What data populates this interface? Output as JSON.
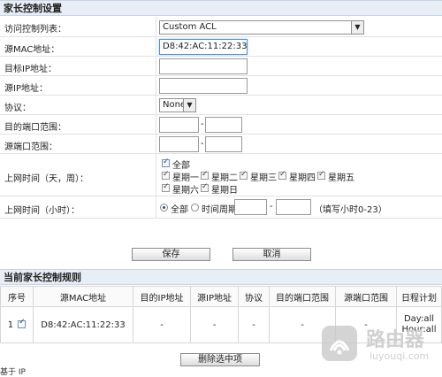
{
  "section1": {
    "title": "家长控制设置"
  },
  "form": {
    "acl_label": "访问控制列表：",
    "acl_value": "Custom ACL",
    "src_mac_label": "源MAC地址：",
    "src_mac_value": "D8:42:AC:11:22:33",
    "dst_ip_label": "目标IP地址：",
    "src_ip_label": "源IP地址：",
    "protocol_label": "协议：",
    "protocol_value": "None",
    "dst_port_label": "目的端口范围：",
    "src_port_label": "源端口范围：",
    "range_dash": "-",
    "week_label": "上网时间（天，周）：",
    "days": {
      "all": "全部",
      "mon": "星期一",
      "tue": "星期二",
      "wed": "星期三",
      "thu": "星期四",
      "fri": "星期五",
      "sat": "星期六",
      "sun": "星期日"
    },
    "hour_label": "上网时间（小时）：",
    "hour_all": "全部",
    "hour_period": "时间周期",
    "hour_hint": "（填写小时0-23）"
  },
  "buttons": {
    "save": "保存",
    "cancel": "取消",
    "delete_selected": "删除选中项"
  },
  "section2": {
    "title": "当前家长控制规则"
  },
  "rules_table": {
    "headers": [
      "序号",
      "源MAC地址",
      "目的IP地址",
      "源IP地址",
      "协议",
      "目的端口范围",
      "源端口范围",
      "日程计划"
    ],
    "rows": [
      {
        "index": "1",
        "src_mac": "D8:42:AC:11:22:33",
        "dst_ip": "-",
        "src_ip": "-",
        "protocol": "-",
        "dst_port": "-",
        "src_port": "-",
        "schedule_day": "Day:all",
        "schedule_hour": "Hour:all"
      }
    ]
  },
  "watermark": {
    "brand_cn": "路由器",
    "brand_url": "luyouqi.com"
  },
  "footer": {
    "partial_text": "基于 IP"
  },
  "colors": {
    "header_bg": "#e8eef6",
    "accent": "#1f4b99"
  }
}
